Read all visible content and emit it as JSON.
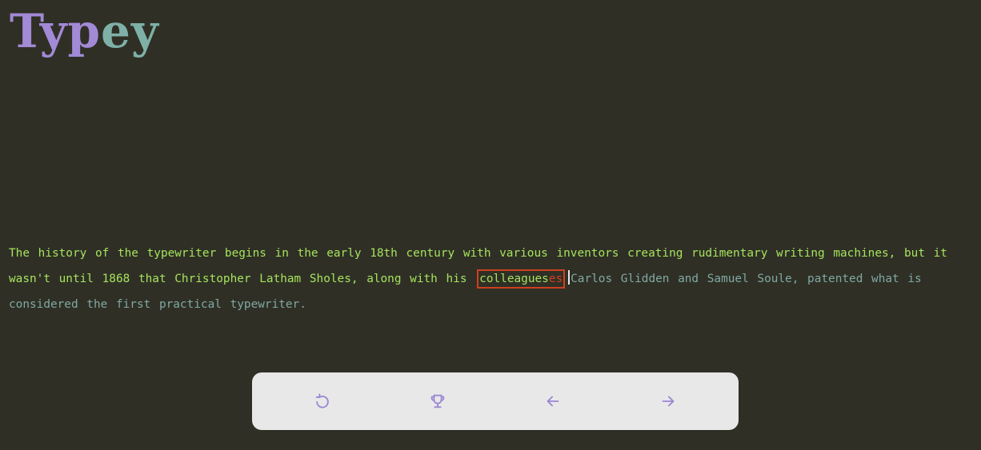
{
  "app": {
    "logo_part1": "Typ",
    "logo_part2": "ey"
  },
  "passage": {
    "typed": "The history of the typewriter begins in the early 18th century with various inventors creating rudimentary writing machines, but it wasn't until 1868 that Christopher Latham Sholes, along with his",
    "current_word_correct": "colleagues",
    "current_word_extra": "es",
    "remaining": "Carlos Glidden and Samuel Soule, patented what is considered the first practical typewriter."
  },
  "colors": {
    "background": "#2f2f26",
    "typed": "#a6e35c",
    "remaining": "#7fa9a2",
    "error": "#d0401e",
    "logo_purple": "#a28ad6",
    "logo_teal": "#7eb0a7",
    "toolbar_bg": "#e8e8e8",
    "icon": "#9b86d2"
  },
  "toolbar": {
    "icons": [
      "restart-icon",
      "trophy-icon",
      "arrow-left-icon",
      "arrow-right-icon"
    ]
  }
}
